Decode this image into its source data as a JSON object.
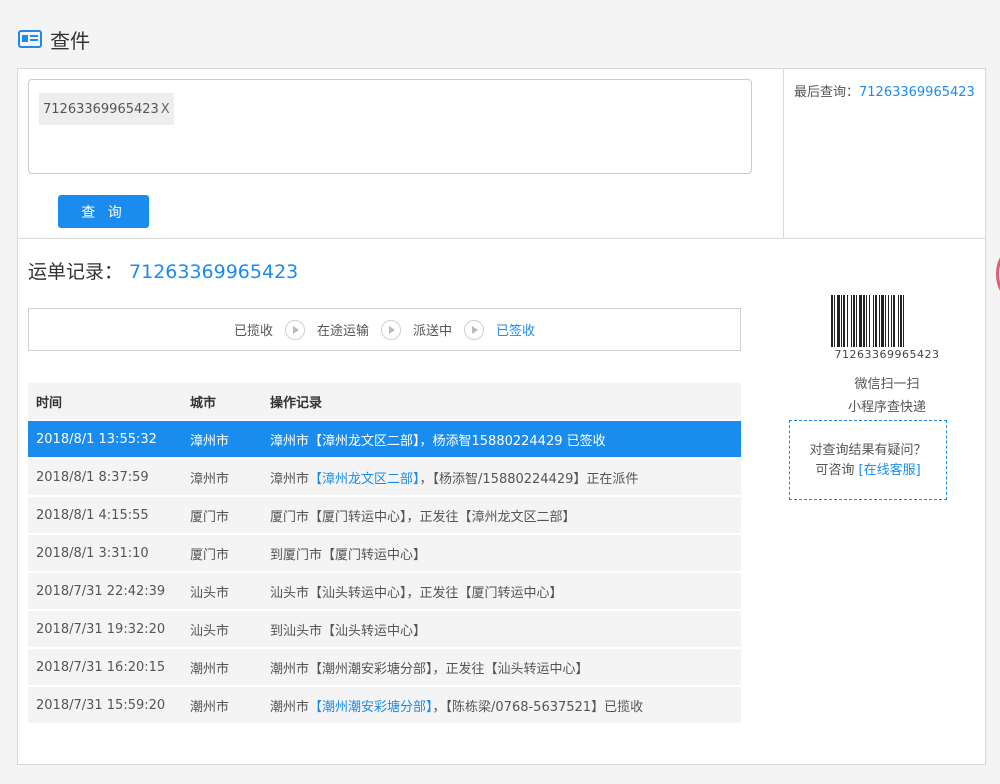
{
  "header": {
    "title": "查件",
    "icon": "id-card-icon"
  },
  "search": {
    "tag_value": "71263369965423",
    "tag_remove": "X",
    "button_label": "查 询"
  },
  "last_query": {
    "label": "最后查询：",
    "number": "71263369965423"
  },
  "record": {
    "label": "运单记录：",
    "number": "71263369965423"
  },
  "status_steps": [
    {
      "label": "已揽收",
      "active": false
    },
    {
      "label": "在途运输",
      "active": false
    },
    {
      "label": "派送中",
      "active": false
    },
    {
      "label": "已签收",
      "active": true
    }
  ],
  "table": {
    "headers": [
      "时间",
      "城市",
      "操作记录"
    ],
    "rows": [
      {
        "time": "2018/8/1 13:55:32",
        "city": "漳州市",
        "pre": "漳州市【漳州龙文区二部】，杨添智15880224429 已签收",
        "link": "",
        "post": "",
        "active": true
      },
      {
        "time": "2018/8/1 8:37:59",
        "city": "漳州市",
        "pre": "漳州市",
        "link": "【漳州龙文区二部】",
        "post": "，【杨添智/15880224429】正在派件",
        "active": false
      },
      {
        "time": "2018/8/1 4:15:55",
        "city": "厦门市",
        "pre": "厦门市【厦门转运中心】，正发往【漳州龙文区二部】",
        "link": "",
        "post": "",
        "active": false
      },
      {
        "time": "2018/8/1 3:31:10",
        "city": "厦门市",
        "pre": "到厦门市【厦门转运中心】",
        "link": "",
        "post": "",
        "active": false
      },
      {
        "time": "2018/7/31 22:42:39",
        "city": "汕头市",
        "pre": "汕头市【汕头转运中心】，正发往【厦门转运中心】",
        "link": "",
        "post": "",
        "active": false
      },
      {
        "time": "2018/7/31 19:32:20",
        "city": "汕头市",
        "pre": "到汕头市【汕头转运中心】",
        "link": "",
        "post": "",
        "active": false
      },
      {
        "time": "2018/7/31 16:20:15",
        "city": "潮州市",
        "pre": "潮州市【潮州潮安彩塘分部】，正发往【汕头转运中心】",
        "link": "",
        "post": "",
        "active": false
      },
      {
        "time": "2018/7/31 15:59:20",
        "city": "潮州市",
        "pre": "潮州市",
        "link": "【潮州潮安彩塘分部】",
        "post": "，【陈栋梁/0768-5637521】已揽收",
        "active": false
      }
    ]
  },
  "side": {
    "barcode_number": "71263369965423",
    "scan_line1": "微信扫一扫",
    "scan_line2": "小程序查快递",
    "help_line1": "对查询结果有疑问？",
    "help_line2": "可咨询",
    "help_link": "[在线客服]"
  },
  "colors": {
    "accent": "#1a8cf0",
    "row_bg": "#f4f4f4",
    "border": "#d9d9d9"
  }
}
